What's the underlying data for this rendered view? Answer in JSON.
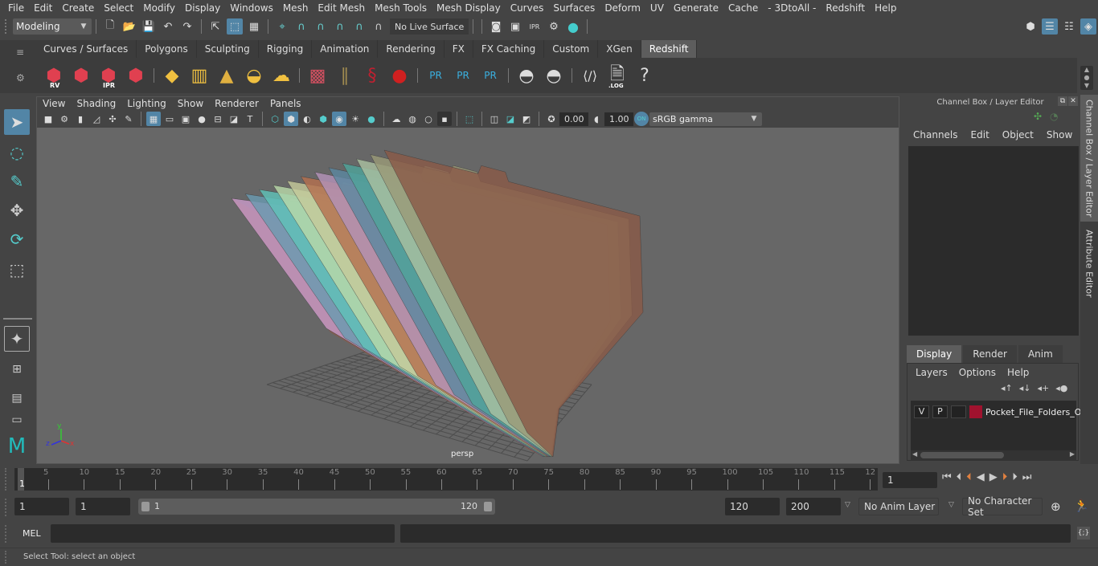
{
  "menubar": {
    "items": [
      "File",
      "Edit",
      "Create",
      "Select",
      "Modify",
      "Display",
      "Windows",
      "Mesh",
      "Edit Mesh",
      "Mesh Tools",
      "Mesh Display",
      "Curves",
      "Surfaces",
      "Deform",
      "UV",
      "Generate",
      "Cache",
      "- 3DtoAll -",
      "Redshift",
      "Help"
    ]
  },
  "statusline": {
    "mode_selector": "Modeling",
    "live_surface": "No Live Surface"
  },
  "shelf": {
    "tabs": [
      "Curves / Surfaces",
      "Polygons",
      "Sculpting",
      "Rigging",
      "Animation",
      "Rendering",
      "FX",
      "FX Caching",
      "Custom",
      "XGen",
      "Redshift"
    ],
    "active_tab": "Redshift",
    "icons": [
      "rv-icon",
      "render-sequence-icon",
      "ipr-icon",
      "render-settings-icon",
      "area-light-icon",
      "portal-light-icon",
      "spot-light-icon",
      "dome-light-icon",
      "sun-sky-icon",
      "proxy-cube-icon",
      "hair-icon",
      "volume-icon",
      "sphere-icon",
      "pr-export-icon",
      "pr-import-icon",
      "pr-swap-icon",
      "pies-icon",
      "pie-icon",
      "script-editor-icon",
      "log-icon",
      "help-icon"
    ],
    "labels": {
      "rv": "RV",
      "ipr": "IPR",
      "pr": "PR",
      "log": ".LOG",
      "help": "?"
    }
  },
  "viewport": {
    "menu": [
      "View",
      "Shading",
      "Lighting",
      "Show",
      "Renderer",
      "Panels"
    ],
    "exposure": "0.00",
    "gamma": "1.00",
    "colorspace_toggle": "ON",
    "colorspace": "sRGB gamma",
    "camera_label": "persp",
    "axis": {
      "x": "x",
      "y": "y",
      "z": "z"
    },
    "folder_colors": [
      "#8a5a48",
      "#9a9a78",
      "#a9c0a0",
      "#4fa39a",
      "#5b87a0",
      "#b392b8",
      "#b5704f",
      "#c4c99a",
      "#b8d8a8",
      "#5fc2b8",
      "#6a9ab0",
      "#c89ac8"
    ]
  },
  "channel_box": {
    "title": "Channel Box / Layer Editor",
    "menu": [
      "Channels",
      "Edit",
      "Object",
      "Show"
    ]
  },
  "layer_editor": {
    "tabs": [
      "Display",
      "Render",
      "Anim"
    ],
    "active_tab": "Display",
    "menu": [
      "Layers",
      "Options",
      "Help"
    ],
    "layers": [
      {
        "v": "V",
        "p": "P",
        "color": "#a0122e",
        "name": "Pocket_File_Folders_O"
      }
    ]
  },
  "side_tabs": [
    "Channel Box / Layer Editor",
    "Attribute Editor"
  ],
  "timeline": {
    "start_marker": "1",
    "ticks": [
      "5",
      "10",
      "15",
      "20",
      "25",
      "30",
      "35",
      "40",
      "45",
      "50",
      "55",
      "60",
      "65",
      "70",
      "75",
      "80",
      "85",
      "90",
      "95",
      "100",
      "105",
      "110",
      "115",
      "12"
    ],
    "current_frame": "1"
  },
  "range": {
    "start": "1",
    "playback_start": "1",
    "slider_start": "1",
    "slider_end": "120",
    "playback_end": "120",
    "end": "200",
    "anim_layer": "No Anim Layer",
    "character_set": "No Character Set"
  },
  "command_line": {
    "language": "MEL",
    "input": "",
    "output": ""
  },
  "help_line": {
    "text": "Select Tool: select an object"
  }
}
